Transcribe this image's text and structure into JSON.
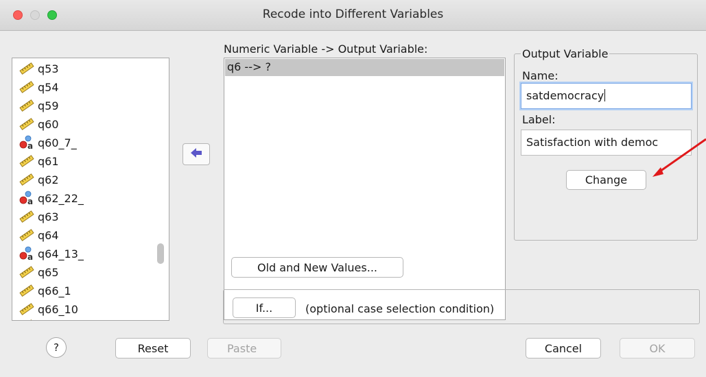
{
  "window": {
    "title": "Recode into Different Variables"
  },
  "variables": {
    "items": [
      {
        "label": "q53",
        "icon": "ruler-icon"
      },
      {
        "label": "q54",
        "icon": "ruler-icon"
      },
      {
        "label": "q59",
        "icon": "ruler-icon"
      },
      {
        "label": "q60",
        "icon": "ruler-icon"
      },
      {
        "label": "q60_7_",
        "icon": "nominal-string-icon"
      },
      {
        "label": "q61",
        "icon": "ruler-icon"
      },
      {
        "label": "q62",
        "icon": "ruler-icon"
      },
      {
        "label": "q62_22_",
        "icon": "nominal-string-icon"
      },
      {
        "label": "q63",
        "icon": "ruler-icon"
      },
      {
        "label": "q64",
        "icon": "ruler-icon"
      },
      {
        "label": "q64_13_",
        "icon": "nominal-string-icon"
      },
      {
        "label": "q65",
        "icon": "ruler-icon"
      },
      {
        "label": "q66_1",
        "icon": "ruler-icon"
      },
      {
        "label": "q66_10",
        "icon": "ruler-icon"
      }
    ]
  },
  "mapping": {
    "label": "Numeric Variable -> Output Variable:",
    "rows": [
      "q6 --> ?"
    ]
  },
  "output_variable": {
    "title": "Output Variable",
    "name_label": "Name:",
    "name_value": "satdemocracy",
    "label_label": "Label:",
    "label_value": "Satisfaction with democ",
    "change_button": "Change"
  },
  "old_new_button": "Old and New Values...",
  "if_section": {
    "button": "If...",
    "note": "(optional case selection condition)"
  },
  "footer": {
    "help": "?",
    "reset": "Reset",
    "paste": "Paste",
    "cancel": "Cancel",
    "ok": "OK"
  },
  "colors": {
    "annotation_arrow": "#e0191b",
    "move_arrow": "#5b57c9",
    "selection": "#c6c6c6",
    "focus_ring": "#7aa7e6"
  }
}
